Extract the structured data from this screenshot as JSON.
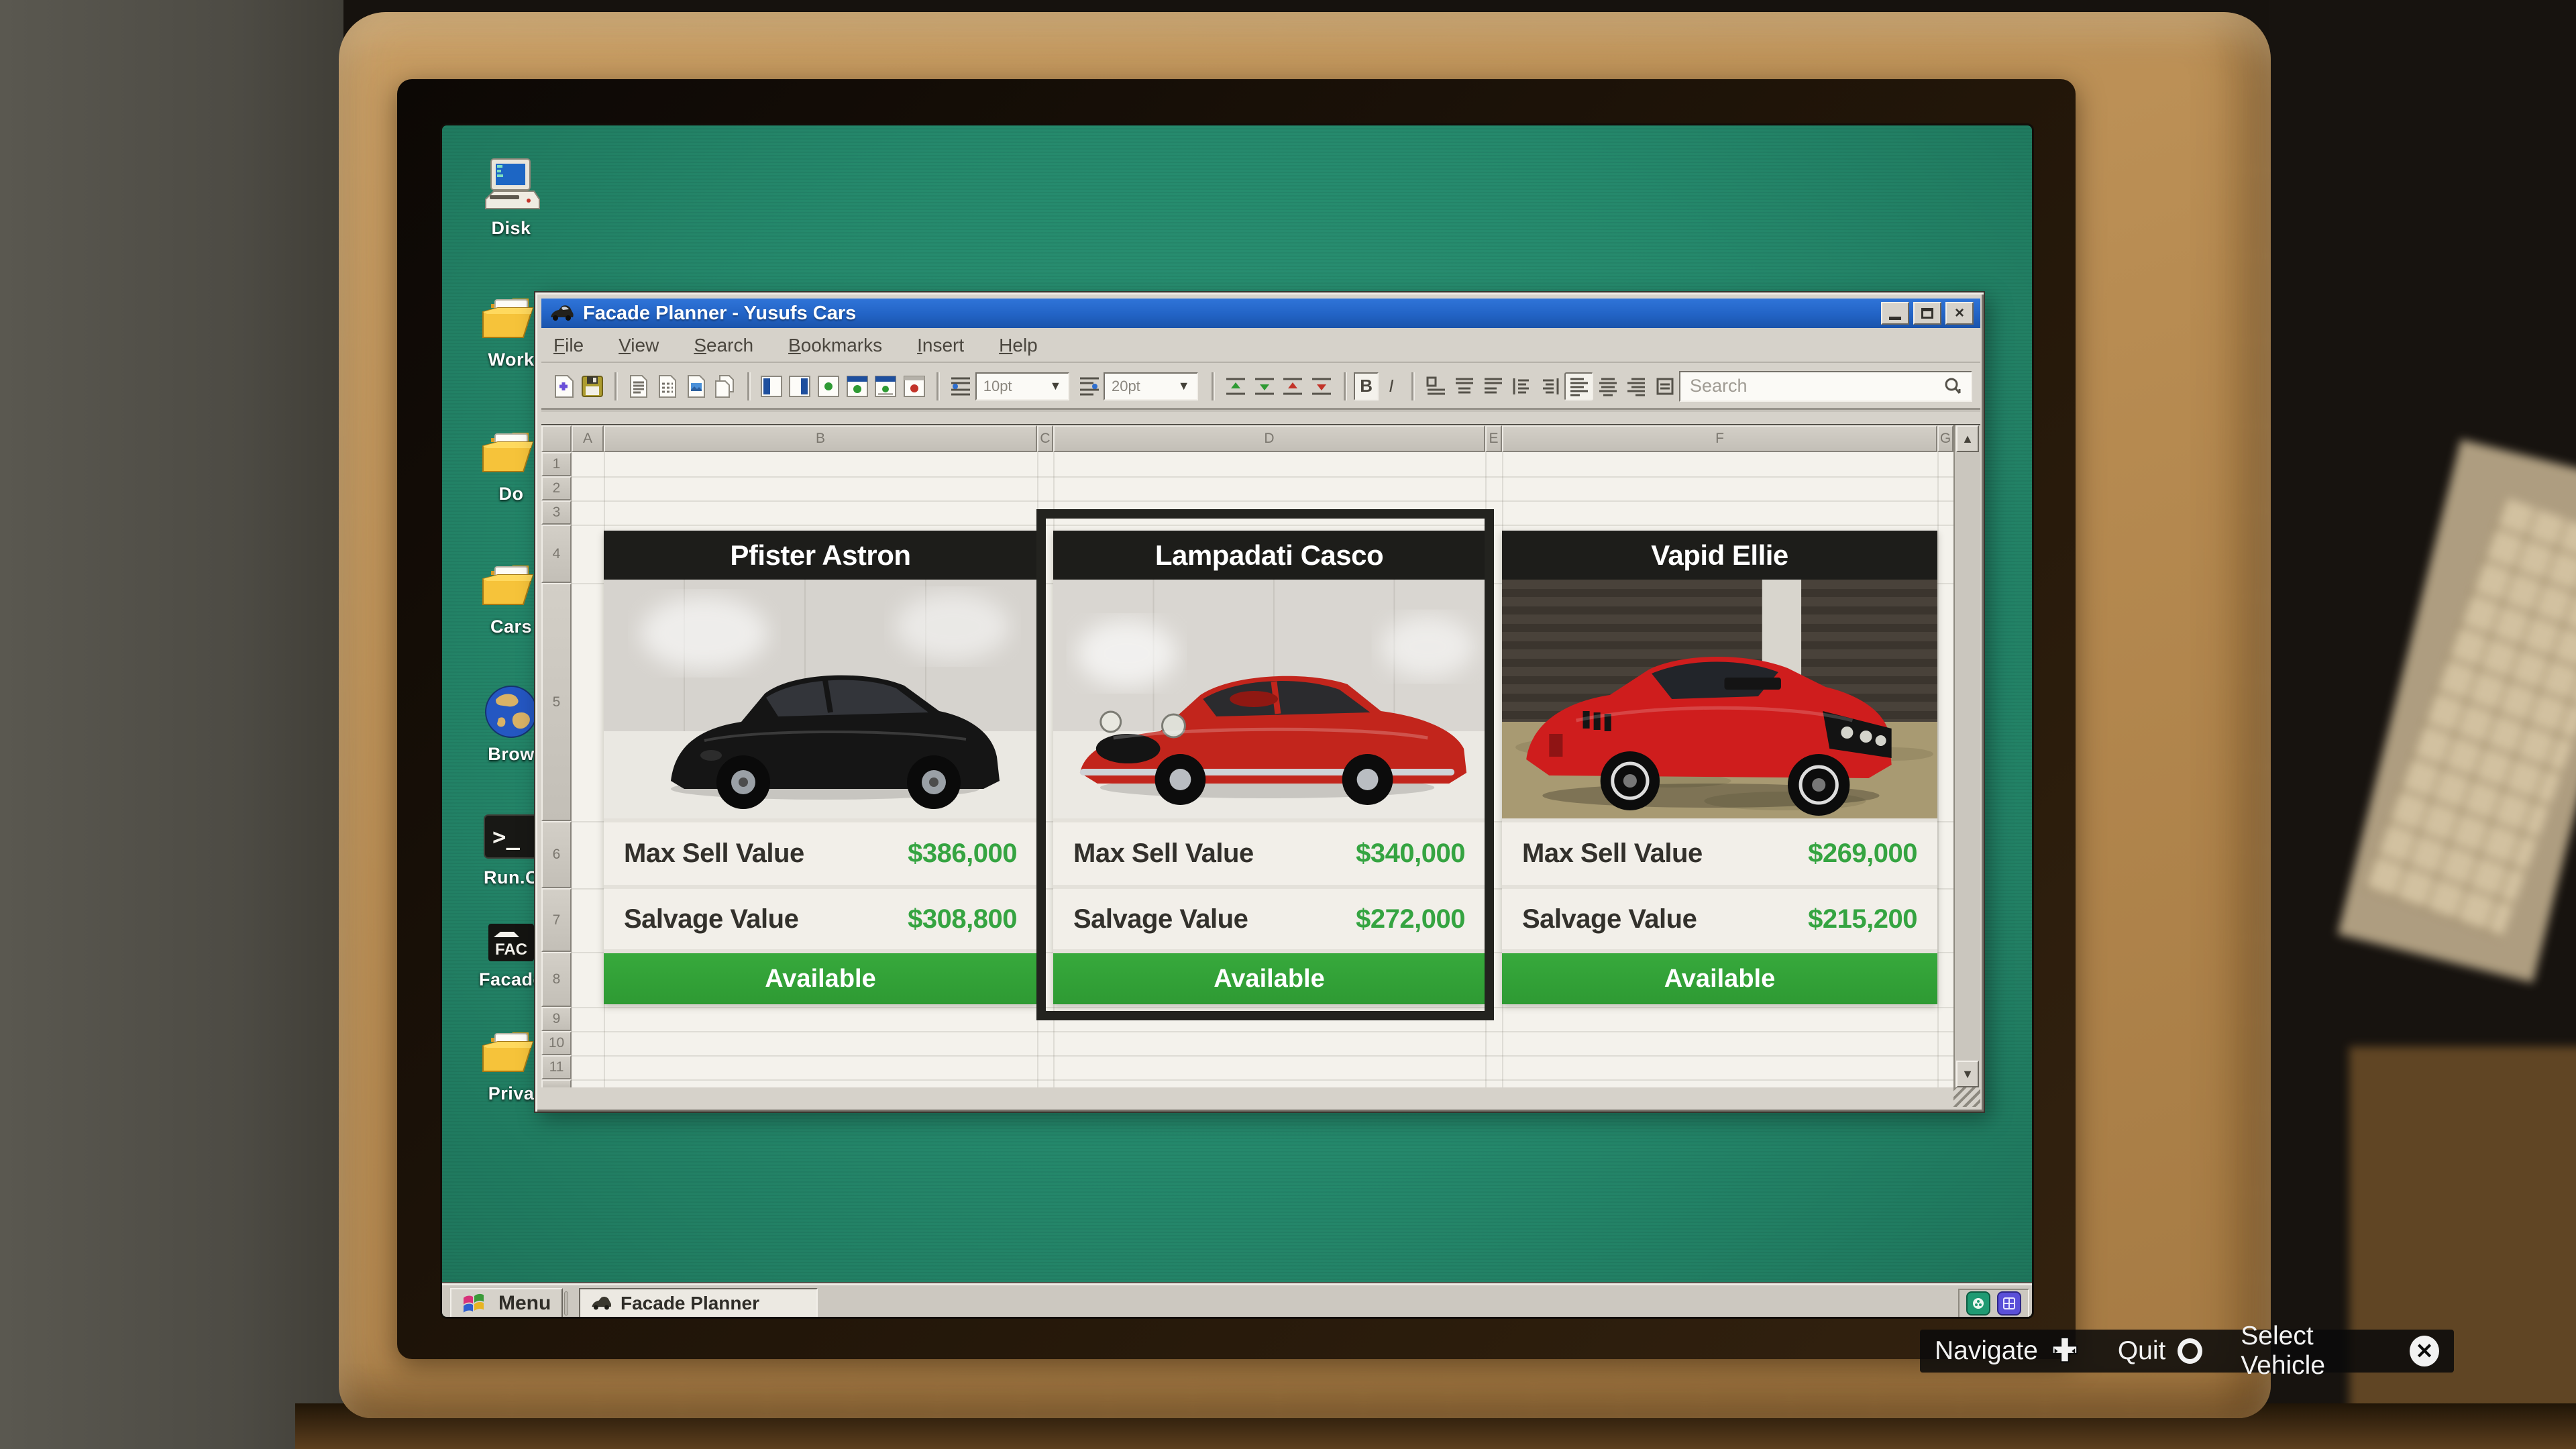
{
  "colors": {
    "desktop_teal": "#25896c",
    "titlebar_blue": "#2263c5",
    "money_green": "#35a441",
    "available_green": "#2e9a33",
    "bezel_tan": "#b88c52",
    "window_gray": "#d6d2ca"
  },
  "desktop": {
    "icons": [
      {
        "label": "Disk",
        "icon": "computer-icon"
      },
      {
        "label": "Work",
        "icon": "folder-icon"
      },
      {
        "label": "Do",
        "icon": "folder-icon"
      },
      {
        "label": "Cars",
        "icon": "folder-icon"
      },
      {
        "label": "Brow",
        "icon": "globe-icon"
      },
      {
        "label": "Run.C",
        "icon": "terminal-icon"
      },
      {
        "label": "Facade",
        "icon": "facade-app-icon"
      },
      {
        "label": "Priva",
        "icon": "folder-icon"
      }
    ]
  },
  "window": {
    "title": "Facade Planner - Yusufs Cars",
    "window_button_icons": [
      "minimize-icon",
      "maximize-icon",
      "close-icon"
    ],
    "menu": [
      "File",
      "View",
      "Search",
      "Bookmarks",
      "Insert",
      "Help"
    ],
    "toolbar": {
      "font_size_small": "10pt",
      "font_size_large": "20pt",
      "bold": "B",
      "italic": "I",
      "search_placeholder": "Search",
      "icon_names": [
        "new-document-icon",
        "save-icon",
        "document-text-icon",
        "document-dashed-icon",
        "document-image-icon",
        "copy-icon",
        "panel-left-icon",
        "panel-right-icon",
        "panel-dot-icon",
        "panel-header-icon",
        "panel-header2-icon",
        "panel-red-icon",
        "line-spacing-icon",
        "paragraph-spacing-icon",
        "row-insert-icon",
        "row-delete-icon",
        "col-insert-icon",
        "col-delete-icon",
        "align-left-icon",
        "align-center-icon",
        "align-right-icon",
        "indent-icon",
        "outdent-icon",
        "justify-left-icon",
        "justify-center-icon",
        "justify-right-icon",
        "justify-full-icon",
        "search-icon"
      ]
    },
    "sheet": {
      "columns": [
        "A",
        "B",
        "C",
        "D",
        "E",
        "F",
        "G"
      ],
      "rows": [
        "1",
        "2",
        "3",
        "4",
        "5",
        "6",
        "7",
        "8",
        "9",
        "10",
        "11"
      ]
    }
  },
  "vehicles": [
    {
      "name": "Pfister Astron",
      "max_sell_label": "Max Sell Value",
      "max_sell_value": "$386,000",
      "salvage_label": "Salvage Value",
      "salvage_value": "$308,800",
      "status": "Available",
      "selected": false
    },
    {
      "name": "Lampadati Casco",
      "max_sell_label": "Max Sell Value",
      "max_sell_value": "$340,000",
      "salvage_label": "Salvage Value",
      "salvage_value": "$272,000",
      "status": "Available",
      "selected": true
    },
    {
      "name": "Vapid Ellie",
      "max_sell_label": "Max Sell Value",
      "max_sell_value": "$269,000",
      "salvage_label": "Salvage Value",
      "salvage_value": "$215,200",
      "status": "Available",
      "selected": false
    }
  ],
  "taskbar": {
    "menu_label": "Menu",
    "active_task": "Facade Planner",
    "tray_icon_names": [
      "green-app-tray-icon",
      "purple-grid-tray-icon"
    ]
  },
  "hud": {
    "navigate_label": "Navigate",
    "quit_label": "Quit",
    "select_vehicle_label": "Select Vehicle",
    "button_icons": [
      "dpad-icon",
      "circle-button-icon",
      "x-button-icon"
    ]
  }
}
